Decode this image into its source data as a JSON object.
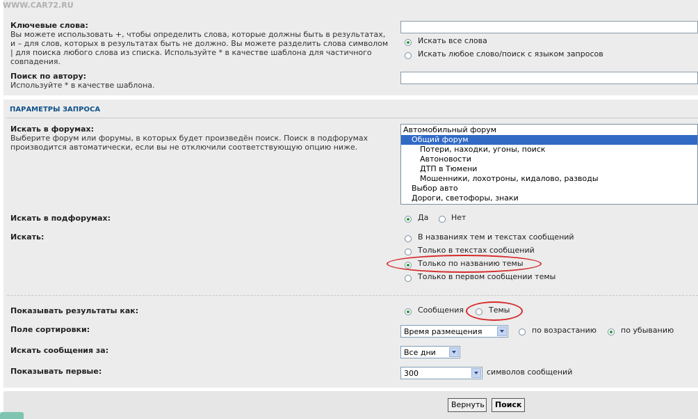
{
  "watermark": "WWW.CAR72.RU",
  "keywords": {
    "label": "Ключевые слова:",
    "desc": "Вы можете использовать +, чтобы определить слова, которые должны быть в результатах, и – для слов, которых в результатах быть не должно. Вы можете разделить слова символом | для поиска любого слова из списка. Используйте * в качестве шаблона для частичного совпадения.",
    "value": "",
    "options": [
      "Искать все слова",
      "Искать любое слово/поиск с языком запросов"
    ]
  },
  "author": {
    "label": "Поиск по автору:",
    "desc": "Используйте * в качестве шаблона.",
    "value": ""
  },
  "params_title": "ПАРАМЕТРЫ ЗАПРОСА",
  "forums": {
    "label": "Искать в форумах:",
    "desc": "Выберите форум или форумы, в которых будет произведён поиск. Поиск в подфорумах производится автоматически, если вы не отключили соответствующую опцию ниже.",
    "items": [
      "Автомобильный форум",
      "Общий форум",
      "Потери, находки, угоны, поиск",
      "Автоновости",
      "ДТП в Тюмени",
      "Мошенники, лохотроны, кидалово, разводы",
      "Выбор авто",
      "Дороги, светофоры, знаки"
    ],
    "selected": "Общий форум"
  },
  "subforums": {
    "label": "Искать в подфорумах:",
    "yes": "Да",
    "no": "Нет"
  },
  "search_in": {
    "label": "Искать:",
    "options": [
      "В названиях тем и текстах сообщений",
      "Только в текстах сообщений",
      "Только по названию темы",
      "Только в первом сообщении темы"
    ]
  },
  "show_as": {
    "label": "Показывать результаты как:",
    "posts": "Сообщения",
    "topics": "Темы"
  },
  "sort": {
    "label": "Поле сортировки:",
    "value": "Время размещения",
    "asc": "по возрастанию",
    "desc": "по убыванию"
  },
  "period": {
    "label": "Искать сообщения за:",
    "value": "Все дни"
  },
  "first": {
    "label": "Показывать первые:",
    "value": "300",
    "suffix": "символов сообщений"
  },
  "buttons": {
    "reset": "Вернуть",
    "search": "Поиск"
  },
  "colors": {
    "panel": "#ececec",
    "accent": "#105289",
    "highlight": "#d62a2a",
    "selection": "#316ac5"
  }
}
